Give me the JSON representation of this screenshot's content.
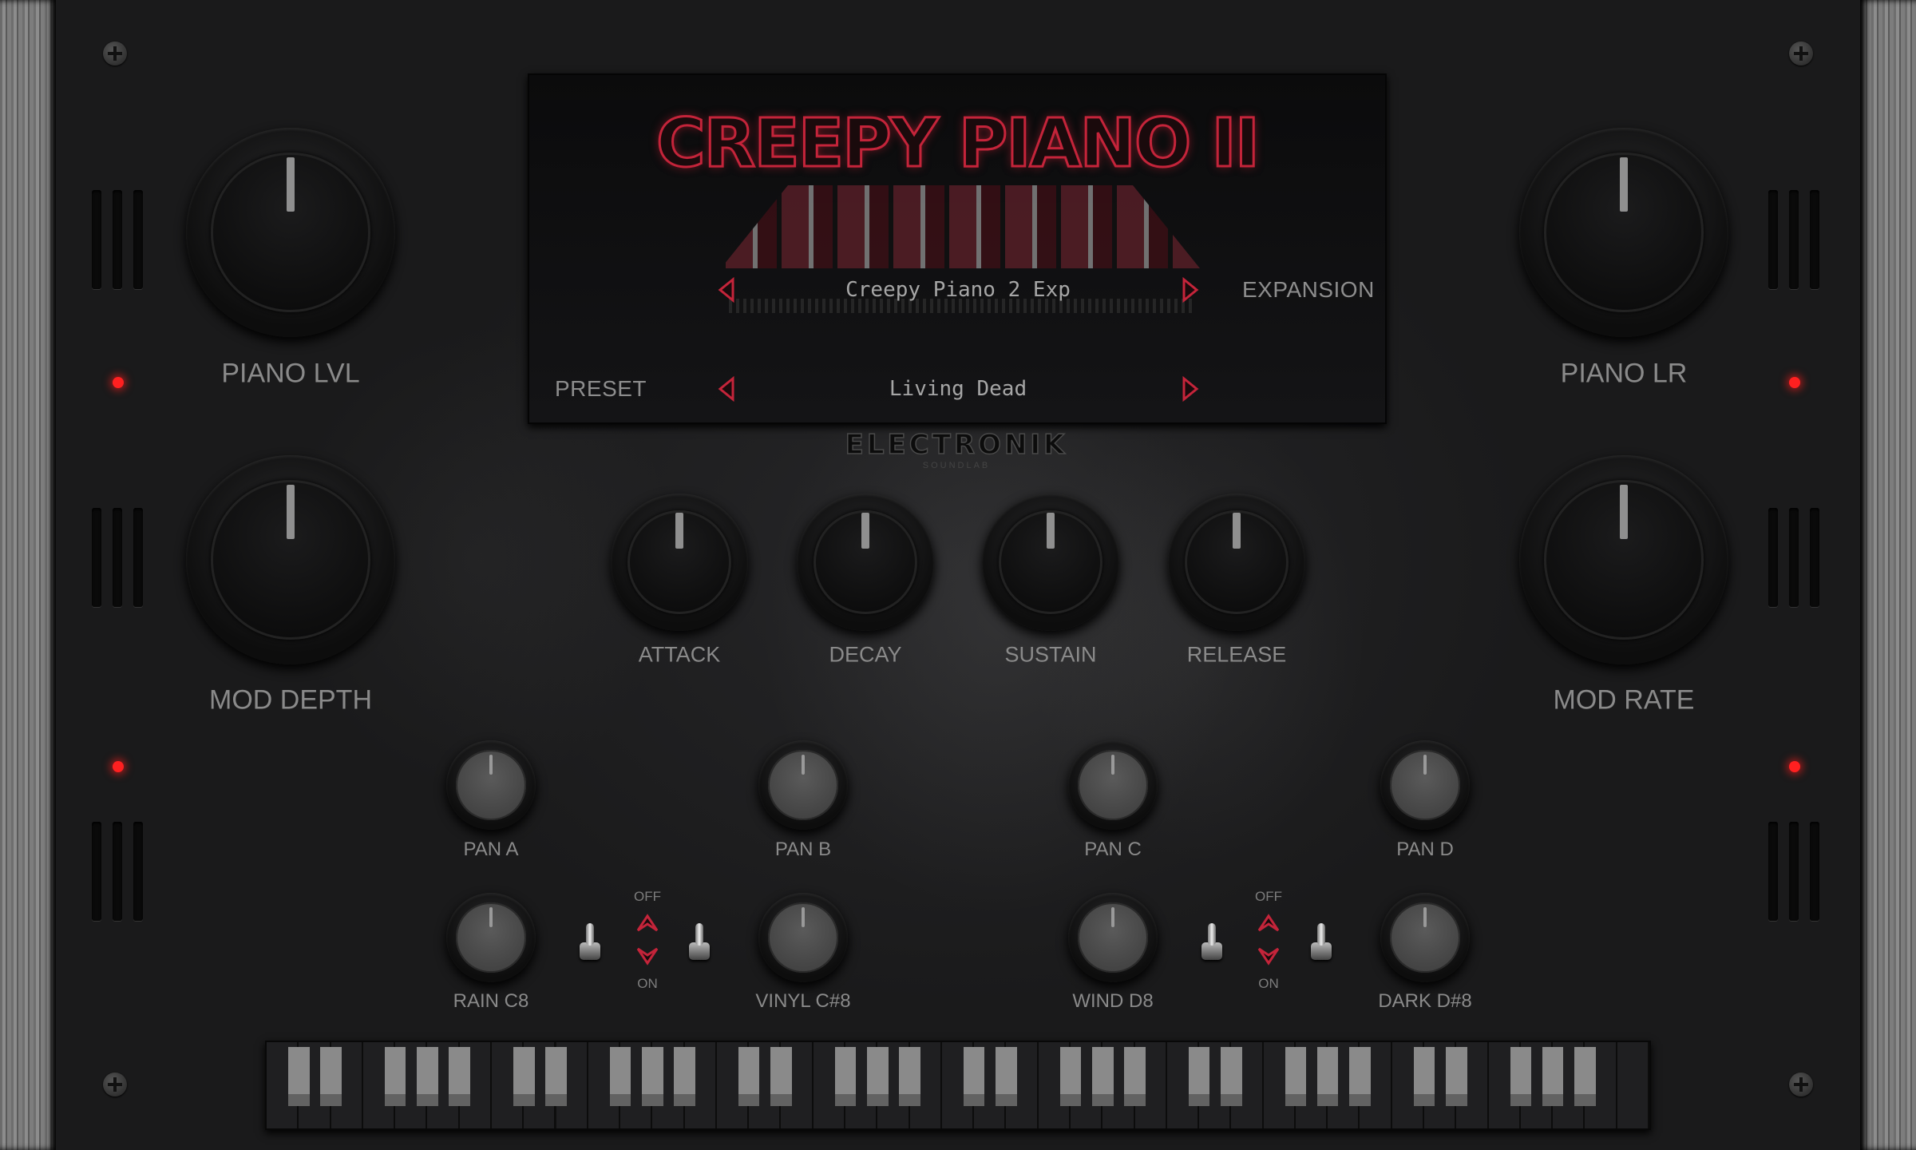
{
  "display": {
    "title": "CREEPY PIANO II",
    "expansion": {
      "value": "Creepy Piano 2 Exp",
      "label": "EXPANSION"
    },
    "preset": {
      "label": "PRESET",
      "value": "Living Dead"
    }
  },
  "logo": {
    "name": "ELECTRONIK",
    "sub": "SOUNDLAB"
  },
  "knobs": {
    "large": [
      {
        "label": "PIANO LVL"
      },
      {
        "label": "MOD DEPTH"
      },
      {
        "label": "PIANO LR"
      },
      {
        "label": "MOD RATE"
      }
    ],
    "envelope": [
      {
        "label": "ATTACK"
      },
      {
        "label": "DECAY"
      },
      {
        "label": "SUSTAIN"
      },
      {
        "label": "RELEASE"
      }
    ],
    "pan": [
      {
        "label": "PAN A"
      },
      {
        "label": "PAN B"
      },
      {
        "label": "PAN C"
      },
      {
        "label": "PAN D"
      }
    ],
    "fx": [
      {
        "label": "RAIN C8"
      },
      {
        "label": "VINYL C#8"
      },
      {
        "label": "WIND D8"
      },
      {
        "label": "DARK D#8"
      }
    ]
  },
  "switches": [
    {
      "off": "OFF",
      "on": "ON"
    },
    {
      "off": "OFF",
      "on": "ON"
    }
  ],
  "colors": {
    "accent": "#c4243a",
    "led": "#ff2020"
  },
  "keyboard": {
    "white_keys": 43
  }
}
